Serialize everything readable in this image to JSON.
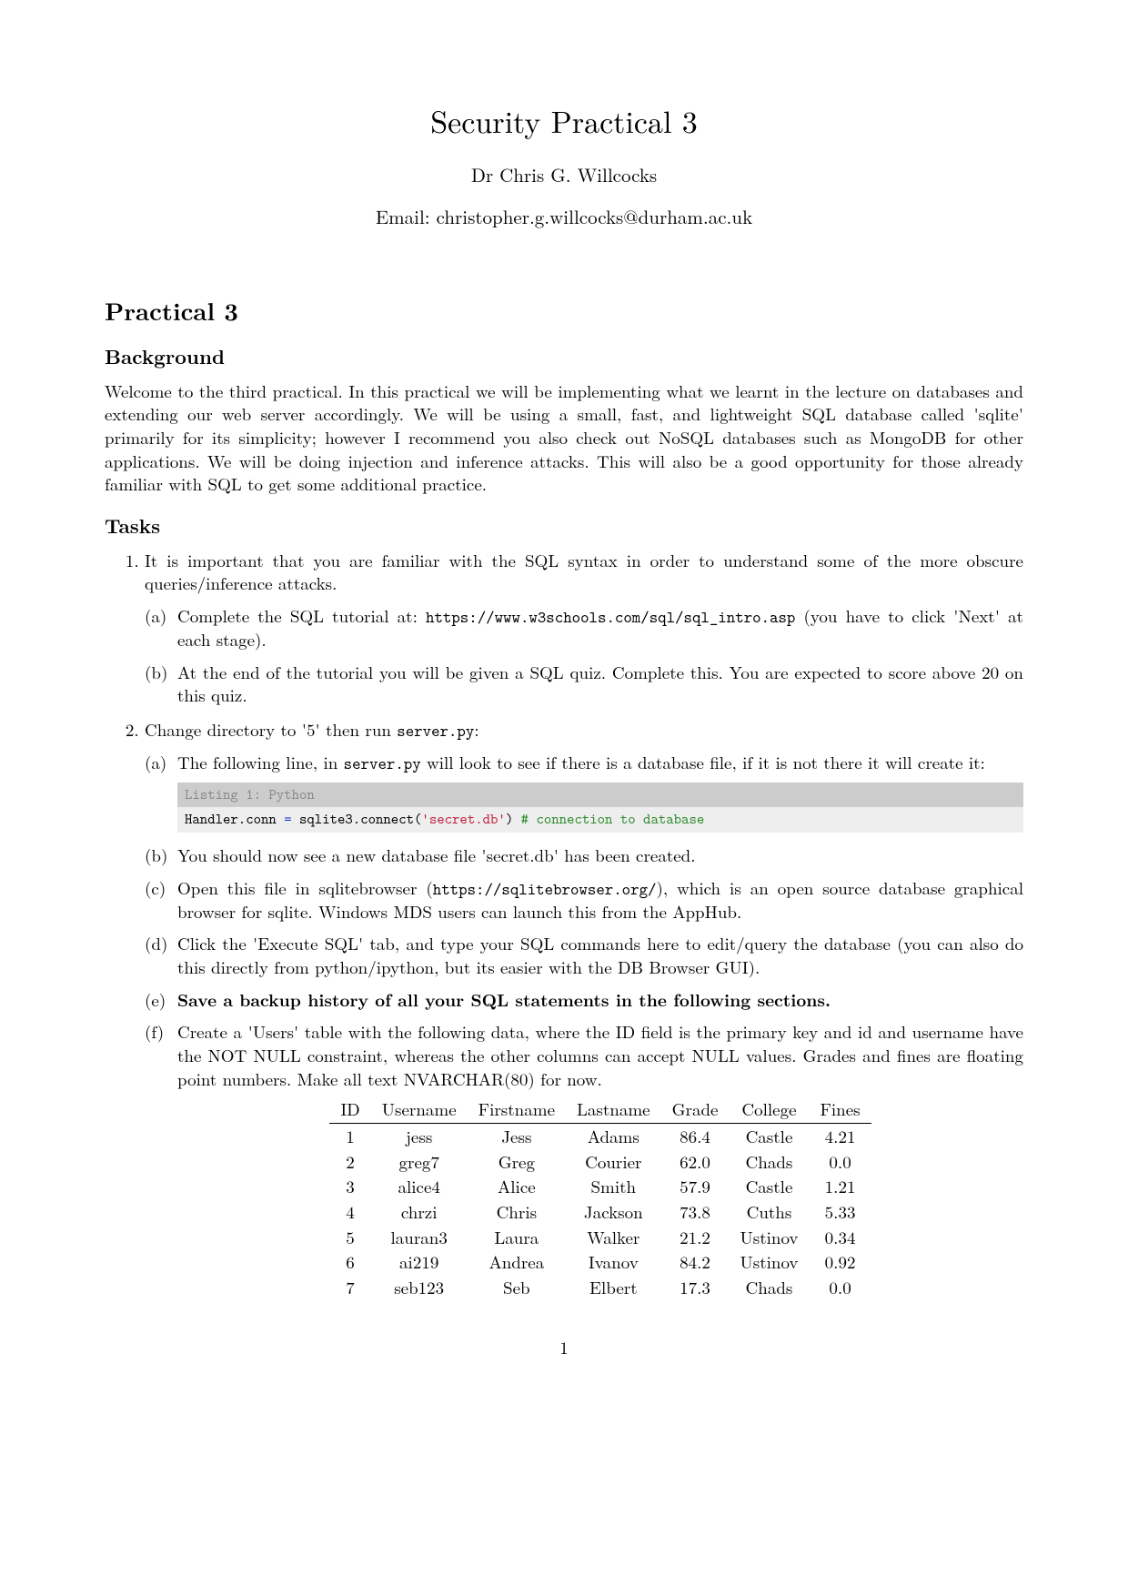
{
  "title": "Security Practical 3",
  "author": "Dr Chris G. Willcocks",
  "email": "Email: christopher.g.willcocks@durham.ac.uk",
  "section_heading": "Practical 3",
  "background_heading": "Background",
  "background_text": "Welcome to the third practical. In this practical we will be implementing what we learnt in the lecture on databases and extending our web server accordingly. We will be using a small, fast, and lightweight SQL database called 'sqlite' primarily for its simplicity; however I recommend you also check out NoSQL databases such as MongoDB for other applications. We will be doing injection and inference attacks. This will also be a good opportunity for those already familiar with SQL to get some additional practice.",
  "tasks_heading": "Tasks",
  "task1": {
    "intro": "It is important that you are familiar with the SQL syntax in order to understand some of the more obscure queries/inference attacks.",
    "a_pre": "Complete the SQL tutorial at: ",
    "a_url": "https://www.w3schools.com/sql/sql_intro.asp",
    "a_post": " (you have to click 'Next' at each stage).",
    "b": "At the end of the tutorial you will be given a SQL quiz. Complete this. You are expected to score above 20 on this quiz."
  },
  "task2": {
    "intro_pre": "Change directory to '5' then run ",
    "intro_cmd": "server.py",
    "intro_post": ":",
    "a_pre": "The following line, in ",
    "a_cmd": "server.py",
    "a_post": " will look to see if there is a database file, if it is not there it will create it:",
    "listing_title": "Listing 1: Python",
    "listing_code_plain": "Handler.conn = sqlite3.connect('secret.db') # connection to database",
    "listing_code": {
      "p1": "Handler.conn ",
      "p2": "=",
      "p3": " sqlite3.connect(",
      "p4": "'secret.db'",
      "p5": ") ",
      "p6": "# connection to database"
    },
    "b": "You should now see a new database file 'secret.db' has been created.",
    "c_pre": "Open this file in sqlitebrowser (",
    "c_url": "https://sqlitebrowser.org/",
    "c_post": "), which is an open source database graphical browser for sqlite. Windows MDS users can launch this from the AppHub.",
    "d": "Click the 'Execute SQL' tab, and type your SQL commands here to edit/query the database (you can also do this directly from python/ipython, but its easier with the DB Browser GUI).",
    "e": "Save a backup history of all your SQL statements in the following sections.",
    "f": "Create a 'Users' table with the following data, where the ID field is the primary key and id and username have the NOT NULL constraint, whereas the other columns can accept NULL values. Grades and fines are floating point numbers. Make all text NVARCHAR(80) for now."
  },
  "table": {
    "headers": [
      "ID",
      "Username",
      "Firstname",
      "Lastname",
      "Grade",
      "College",
      "Fines"
    ],
    "rows": [
      {
        "id": "1",
        "user": "jess",
        "first": "Jess",
        "last": "Adams",
        "grade": "86.4",
        "college": "Castle",
        "fines": "4.21"
      },
      {
        "id": "2",
        "user": "greg7",
        "first": "Greg",
        "last": "Courier",
        "grade": "62.0",
        "college": "Chads",
        "fines": "0.0"
      },
      {
        "id": "3",
        "user": "alice4",
        "first": "Alice",
        "last": "Smith",
        "grade": "57.9",
        "college": "Castle",
        "fines": "1.21"
      },
      {
        "id": "4",
        "user": "chrzi",
        "first": "Chris",
        "last": "Jackson",
        "grade": "73.8",
        "college": "Cuths",
        "fines": "5.33"
      },
      {
        "id": "5",
        "user": "lauran3",
        "first": "Laura",
        "last": "Walker",
        "grade": "21.2",
        "college": "Ustinov",
        "fines": "0.34"
      },
      {
        "id": "6",
        "user": "ai219",
        "first": "Andrea",
        "last": "Ivanov",
        "grade": "84.2",
        "college": "Ustinov",
        "fines": "0.92"
      },
      {
        "id": "7",
        "user": "seb123",
        "first": "Seb",
        "last": "Elbert",
        "grade": "17.3",
        "college": "Chads",
        "fines": "0.0"
      }
    ]
  },
  "page_number": "1"
}
